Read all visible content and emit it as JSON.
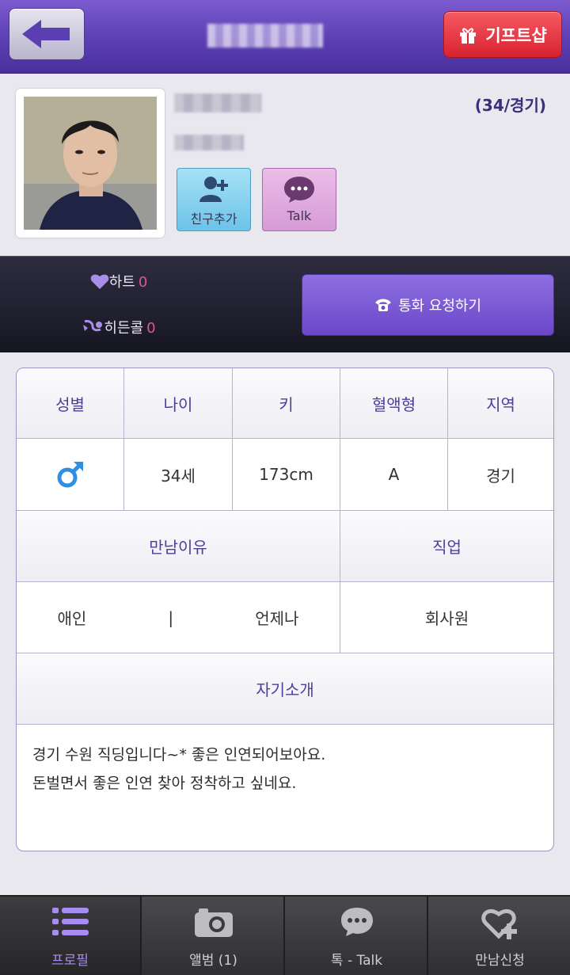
{
  "header": {
    "title": "••••••",
    "gift_label": "기프트샵",
    "back_icon": "back-arrow-icon"
  },
  "profile": {
    "nickname": "•••••",
    "status": "••••",
    "age_region": "(34/경기)",
    "friend_add_label": "친구추가",
    "talk_label": "Talk"
  },
  "stats": {
    "heart_label": "하트",
    "heart_value": "0",
    "hidden_call_label": "히든콜",
    "hidden_call_value": "0",
    "call_request_label": "통화 요청하기"
  },
  "info": {
    "headers": [
      "성별",
      "나이",
      "키",
      "혈액형",
      "지역"
    ],
    "values": {
      "gender_icon": "male-icon",
      "age": "34세",
      "height": "173cm",
      "blood": "A",
      "region": "경기"
    },
    "reason_header": "만남이유",
    "job_header": "직업",
    "reason_1": "애인",
    "reason_sep": "|",
    "reason_2": "언제나",
    "job": "회사원",
    "intro_header": "자기소개",
    "intro_line1": "경기 수원 직딩입니다~*  좋은 인연되어보아요.",
    "intro_line2": "돈벌면서 좋은 인연 찾아 정착하고 싶네요."
  },
  "tabs": [
    {
      "label": "프로필",
      "icon": "list-icon",
      "active": true
    },
    {
      "label": "앨범 (1)",
      "icon": "camera-icon",
      "active": false
    },
    {
      "label": "톡 - Talk",
      "icon": "chat-bubble-icon",
      "active": false
    },
    {
      "label": "만남신청",
      "icon": "heart-plus-icon",
      "active": false
    }
  ],
  "colors": {
    "header_purple": "#5b3fb2",
    "gift_red": "#e0303b",
    "accent_text": "#4a3f9e",
    "stat_value_pink": "#e4529c",
    "tab_active": "#a98cf0"
  }
}
